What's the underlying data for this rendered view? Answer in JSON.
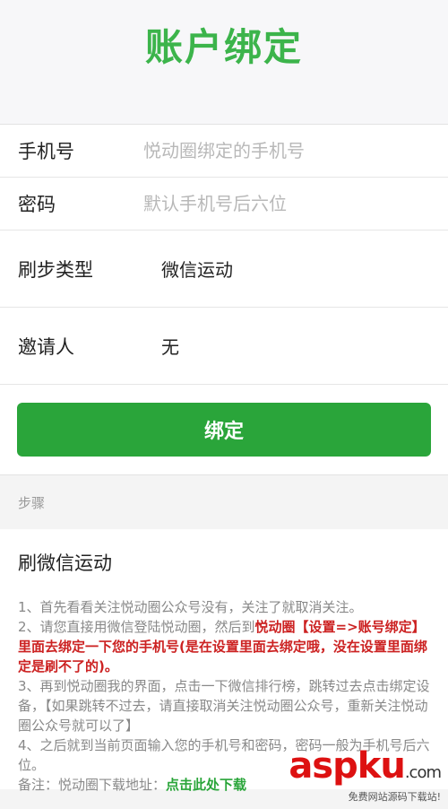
{
  "header": {
    "title": "账户绑定"
  },
  "form": {
    "phone": {
      "label": "手机号",
      "placeholder": "悦动圈绑定的手机号"
    },
    "password": {
      "label": "密码",
      "placeholder": "默认手机号后六位"
    },
    "step_type": {
      "label": "刷步类型",
      "value": "微信运动"
    },
    "inviter": {
      "label": "邀请人",
      "value": "无"
    }
  },
  "bind_button": {
    "label": "绑定"
  },
  "steps": {
    "label": "步骤"
  },
  "section": {
    "title": "刷微信运动",
    "line1": "1、首先看看关注悦动圈公众号没有，关注了就取消关注。",
    "line2_prefix": "2、请您直接用微信登陆悦动圈，然后到",
    "line2_highlight": "悦动圈【设置=>账号绑定】里面去绑定一下您的手机号(是在设置里面去绑定哦，没在设置里面绑定是刷不了的)。",
    "line3": "3、再到悦动圈我的界面，点击一下微信排行榜，跳转过去点击绑定设备，【如果跳转不过去，请直接取消关注悦动圈公众号，重新关注悦动圈公众号就可以了】",
    "line4": "4、之后就到当前页面输入您的手机号和密码，密码一般为手机号后六位。",
    "note_prefix": "备注：悦动圈下载地址：",
    "download_link": "点击此处下载"
  },
  "watermark": {
    "logo": "aspku",
    "suffix": ".com",
    "tagline": "免费网站源码下载站!"
  }
}
